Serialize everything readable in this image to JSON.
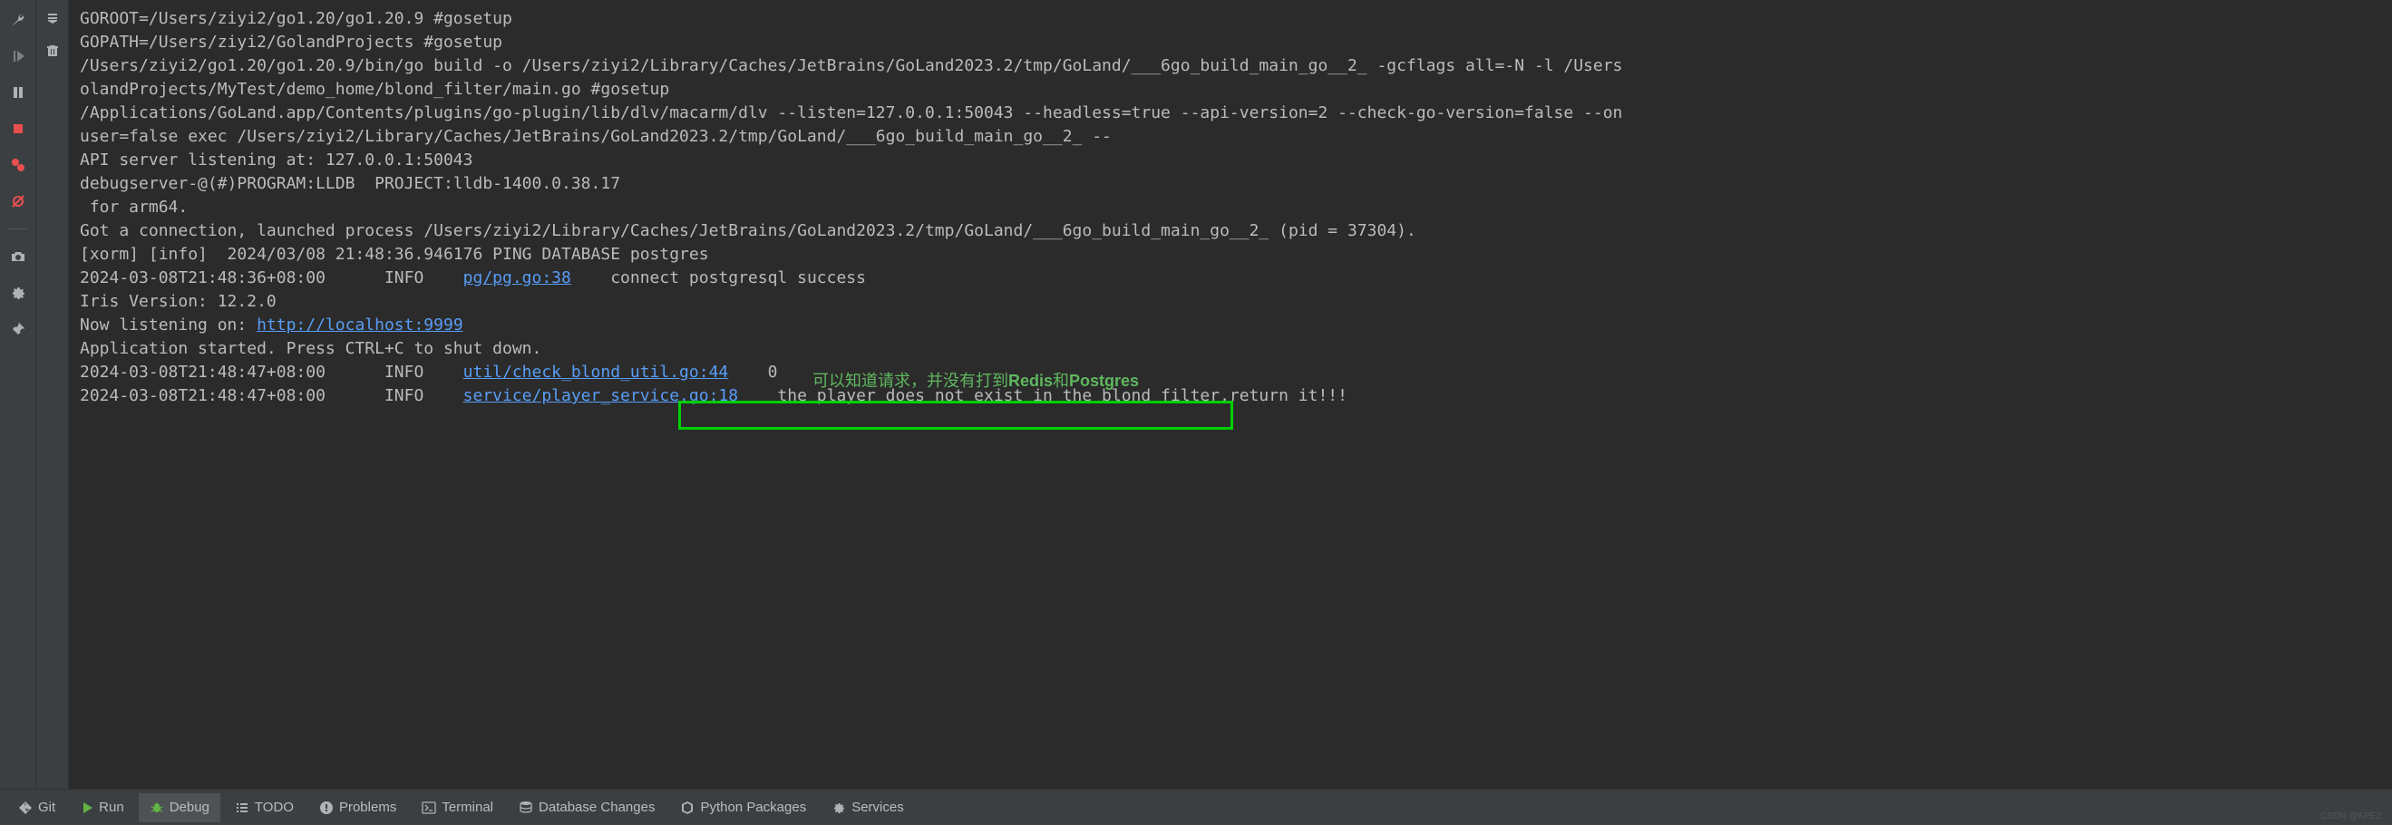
{
  "console": {
    "line1": "GOROOT=/Users/ziyi2/go1.20/go1.20.9 #gosetup",
    "line2": "GOPATH=/Users/ziyi2/GolandProjects #gosetup",
    "line3": "/Users/ziyi2/go1.20/go1.20.9/bin/go build -o /Users/ziyi2/Library/Caches/JetBrains/GoLand2023.2/tmp/GoLand/___6go_build_main_go__2_ -gcflags all=-N -l /Users",
    "line4": "olandProjects/MyTest/demo_home/blond_filter/main.go #gosetup",
    "line5": "/Applications/GoLand.app/Contents/plugins/go-plugin/lib/dlv/macarm/dlv --listen=127.0.0.1:50043 --headless=true --api-version=2 --check-go-version=false --on",
    "line6": "user=false exec /Users/ziyi2/Library/Caches/JetBrains/GoLand2023.2/tmp/GoLand/___6go_build_main_go__2_ --",
    "line7": "API server listening at: 127.0.0.1:50043",
    "line8": "debugserver-@(#)PROGRAM:LLDB  PROJECT:lldb-1400.0.38.17",
    "line9": " for arm64.",
    "line10": "Got a connection, launched process /Users/ziyi2/Library/Caches/JetBrains/GoLand2023.2/tmp/GoLand/___6go_build_main_go__2_ (pid = 37304).",
    "line11": "[xorm] [info]  2024/03/08 21:48:36.946176 PING DATABASE postgres",
    "line12_pre": "2024-03-08T21:48:36+08:00      INFO    ",
    "line12_link": "pg/pg.go:38",
    "line12_post": "    connect postgresql success",
    "line13": "Iris Version: 12.2.0",
    "line14": "",
    "line15_pre": "Now listening on: ",
    "line15_link": "http://localhost:9999",
    "line16": "Application started. Press CTRL+C to shut down.",
    "line17_pre": "2024-03-08T21:48:47+08:00      INFO    ",
    "line17_link": "util/check_blond_util.go:44",
    "line17_post": "    0",
    "line18_pre": "2024-03-08T21:48:47+08:00      INFO    ",
    "line18_link": "service/player_service.go:18",
    "line18_post": "    the player does not exist in the blond filter,return it!!!"
  },
  "annotation": {
    "text_pre": "可以知道请求，并没有打到",
    "redis": "Redis",
    "and": "和",
    "postgres": "Postgres"
  },
  "bottom": {
    "git": "Git",
    "run": "Run",
    "debug": "Debug",
    "todo": "TODO",
    "problems": "Problems",
    "terminal": "Terminal",
    "db_changes": "Database Changes",
    "python_packages": "Python Packages",
    "services": "Services"
  },
  "watermark": "CSDN @KPE2"
}
